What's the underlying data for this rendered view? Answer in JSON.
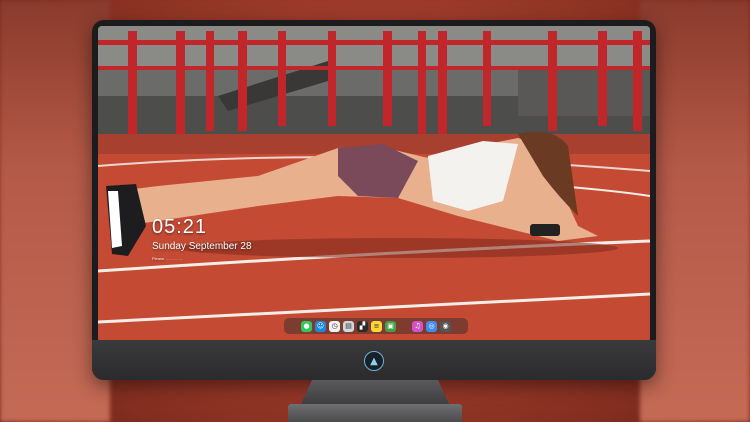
{
  "lock_screen": {
    "time": "05:21",
    "date": "Sunday September  28",
    "tagline": "Please ... ... ... ..."
  },
  "dock": {
    "items": [
      {
        "name": "messages-icon",
        "color": "#34c759",
        "glyph": "●"
      },
      {
        "name": "finder-icon",
        "color": "#1e88e5",
        "glyph": "☺"
      },
      {
        "name": "clock-icon",
        "color": "#f2f2f2",
        "glyph": "◷"
      },
      {
        "name": "preview-icon",
        "color": "#cfd8dc",
        "glyph": "▤"
      },
      {
        "name": "claquette-icon",
        "color": "#2b2b2b",
        "glyph": "▞"
      },
      {
        "name": "notes-icon",
        "color": "#fdd835",
        "glyph": "≡"
      },
      {
        "name": "photos-icon",
        "color": "#43a047",
        "glyph": "▣"
      },
      {
        "name": "itunes-icon",
        "color": "#d252c8",
        "glyph": "♫"
      },
      {
        "name": "safari-icon",
        "color": "#3d8ef0",
        "glyph": "◎"
      },
      {
        "name": "screenshot-icon",
        "color": "#555555",
        "glyph": "◉"
      }
    ]
  }
}
